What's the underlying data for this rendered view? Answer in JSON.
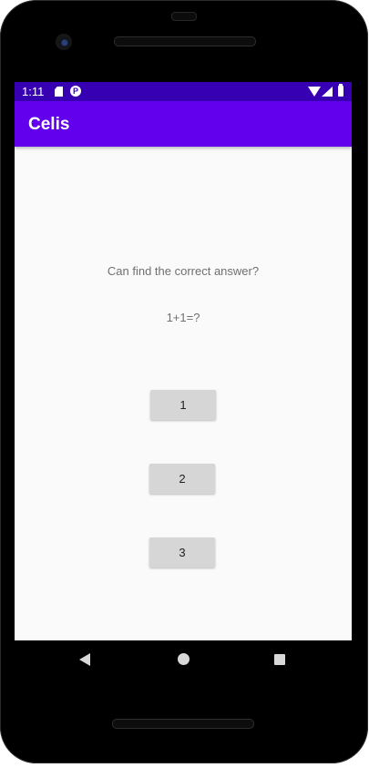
{
  "status_bar": {
    "time": "1:11",
    "icons": [
      "sd-card-icon",
      "p-notification-icon",
      "wifi-icon",
      "signal-icon",
      "battery-icon"
    ],
    "background": "#3700b3"
  },
  "app_bar": {
    "title": "Celis",
    "background": "#6200ee"
  },
  "main": {
    "question": "Can find the correct answer?",
    "problem": "1+1=?",
    "answers": [
      "1",
      "2",
      "3"
    ]
  },
  "nav_bar": {
    "icons": [
      "back-icon",
      "home-icon",
      "recents-icon"
    ]
  }
}
